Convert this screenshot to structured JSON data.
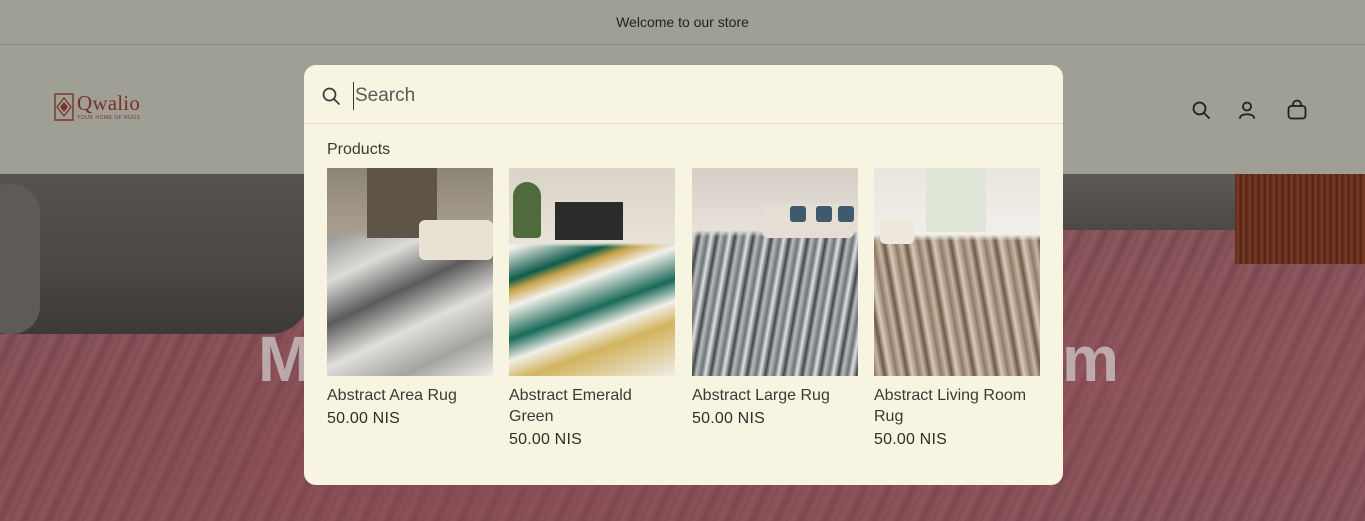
{
  "announcement": {
    "text": "Welcome to our store"
  },
  "brand": {
    "name": "Qwalio",
    "tagline": "YOUR HOME OF RUGS",
    "color": "#7a3128"
  },
  "header": {
    "icons": [
      "search-icon",
      "account-icon",
      "cart-icon"
    ]
  },
  "hero": {
    "title_left": "M",
    "title_right": "m"
  },
  "search": {
    "placeholder": "Search",
    "value": ""
  },
  "results": {
    "section_title": "Products",
    "products": [
      {
        "name": "Abstract Area Rug",
        "price": "50.00 NIS"
      },
      {
        "name": "Abstract Emerald Green",
        "price": "50.00 NIS"
      },
      {
        "name": "Abstract Large Rug",
        "price": "50.00 NIS"
      },
      {
        "name": "Abstract Living Room Rug",
        "price": "50.00 NIS"
      }
    ]
  },
  "colors": {
    "header_bg": "#a09f95",
    "modal_bg": "#f7f4e2",
    "text": "#3b3a35"
  }
}
